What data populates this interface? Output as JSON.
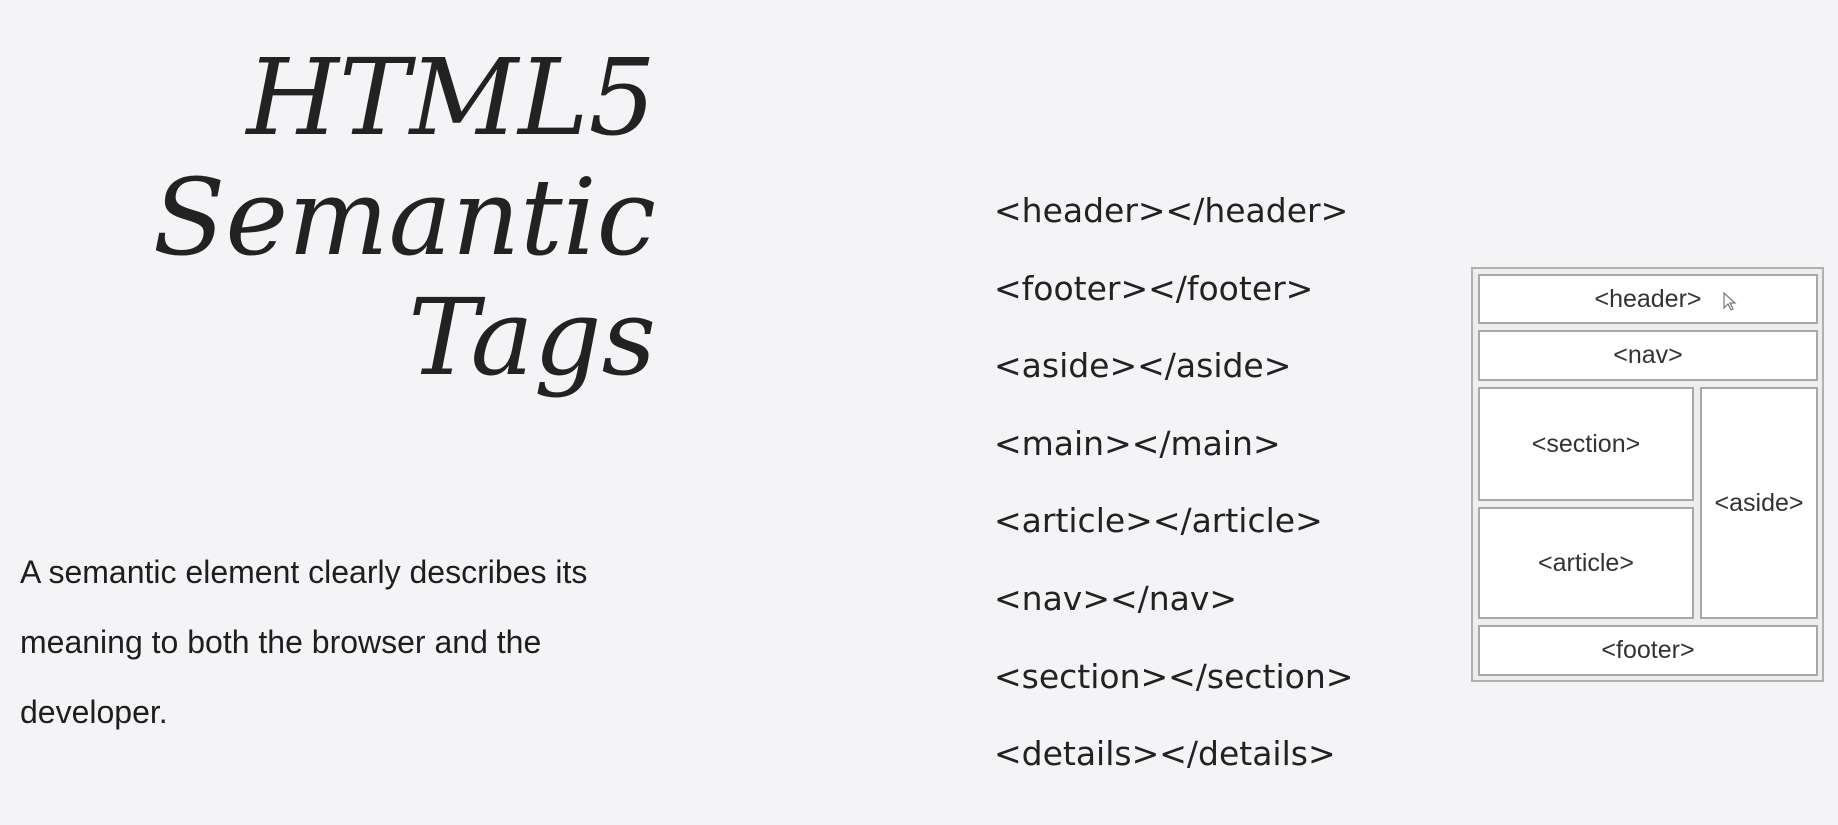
{
  "title": {
    "lines": [
      "HTML5",
      "Semantic",
      "Tags"
    ]
  },
  "description": "A semantic element clearly describes its meaning to both the browser and the developer.",
  "tag_list": [
    "<header></header>",
    "<footer></footer>",
    "<aside></aside>",
    "<main></main>",
    "<article></article>",
    "<nav></nav>",
    "<section></section>",
    "<details></details>"
  ],
  "diagram": {
    "header": "<header>",
    "nav": "<nav>",
    "section": "<section>",
    "article": "<article>",
    "aside": "<aside>",
    "footer": "<footer>"
  },
  "icons": {
    "cursor": "mouse-pointer-icon"
  }
}
